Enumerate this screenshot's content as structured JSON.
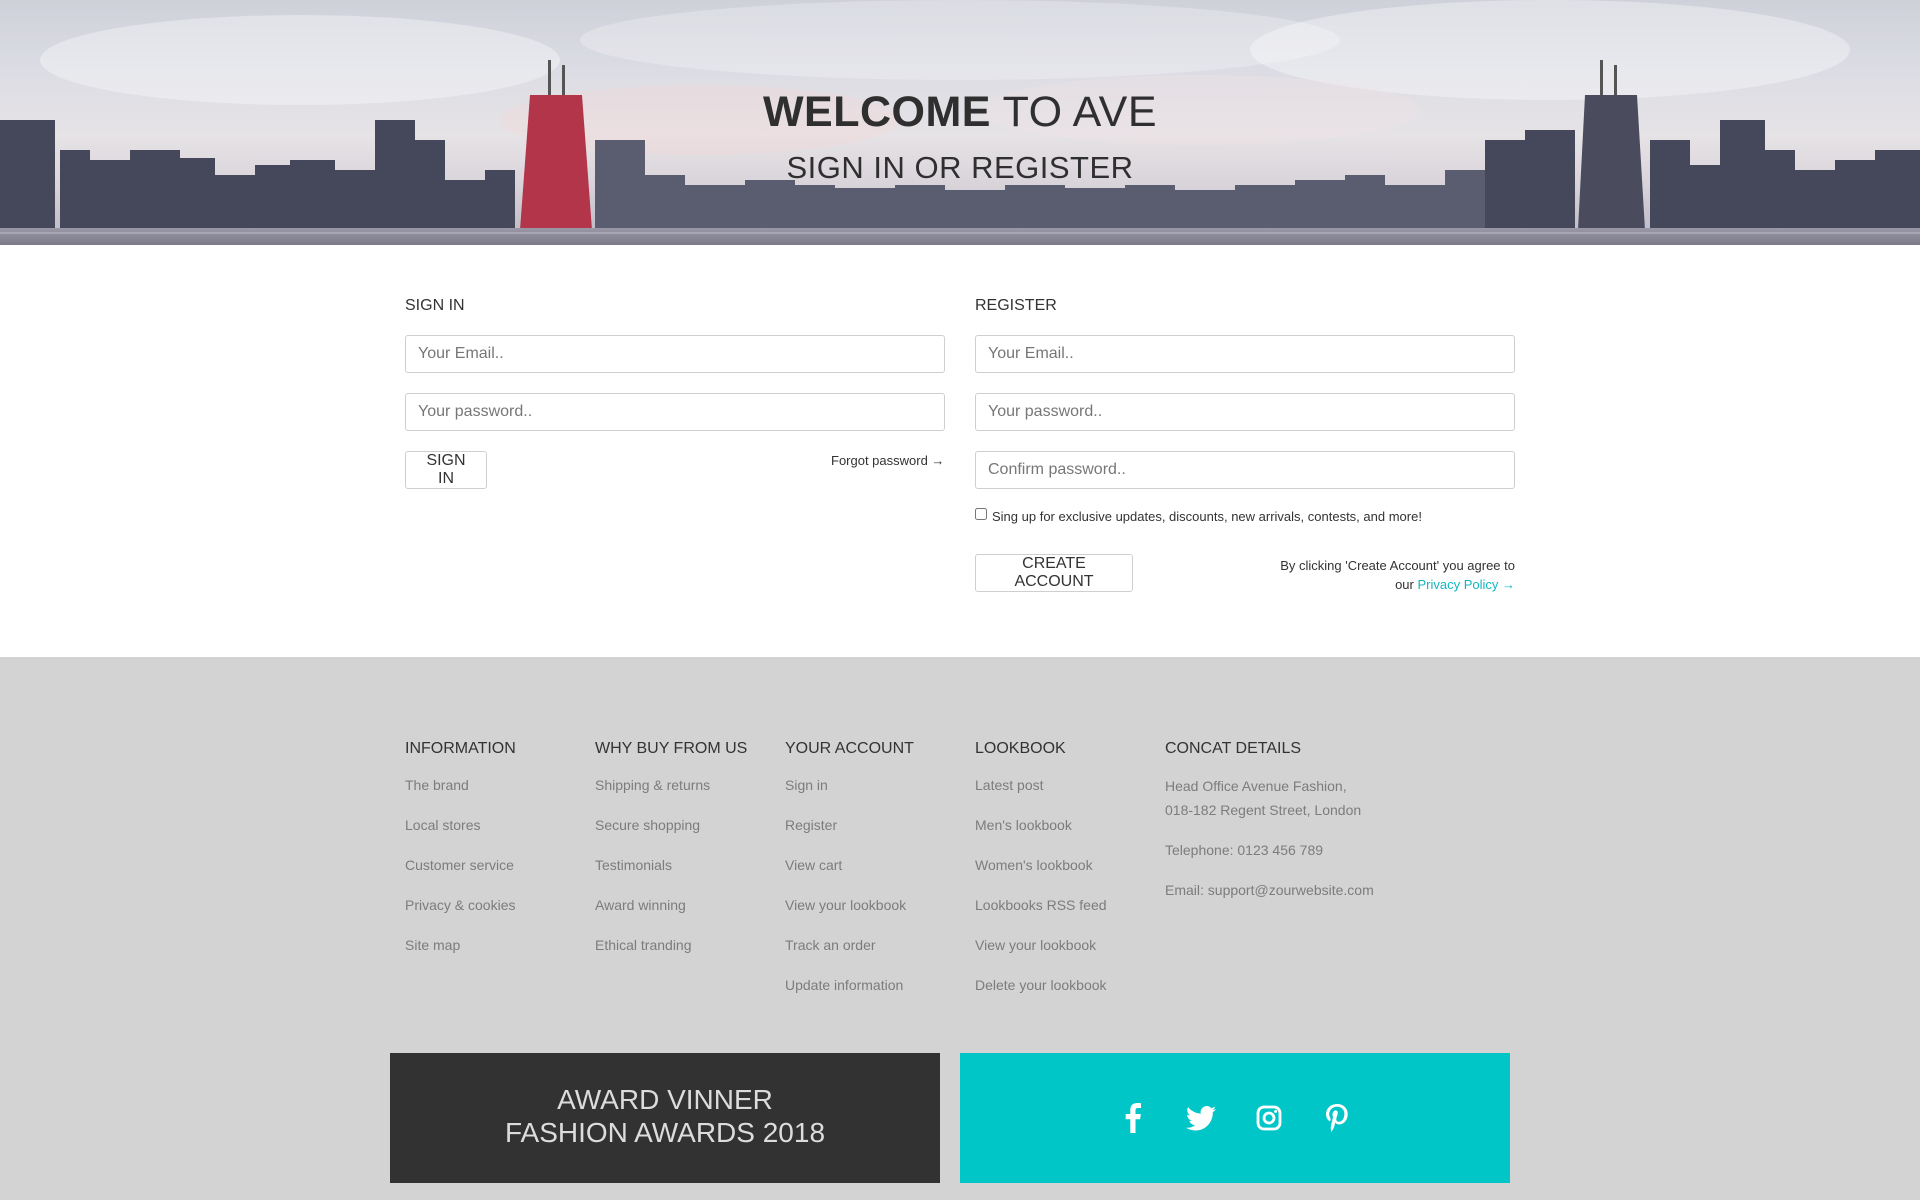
{
  "hero": {
    "title_bold": "WELCOME",
    "title_rest": " TO AVE",
    "subtitle": "SIGN IN OR REGISTER"
  },
  "signin": {
    "heading": "SIGN IN",
    "email_placeholder": "Your Email..",
    "password_placeholder": "Your password..",
    "button": "SIGN IN",
    "forgot": "Forgot password →"
  },
  "register": {
    "heading": "REGISTER",
    "email_placeholder": "Your Email..",
    "password_placeholder": "Your password..",
    "confirm_placeholder": "Confirm password..",
    "newsletter": "Sing up for exclusive updates, discounts, new arrivals, contests, and more!",
    "button": "CREATE ACCOUNT",
    "agree_text": "By clicking 'Create Account' you agree to",
    "agree_prefix": "our ",
    "privacy_link": "Privacy Policy →"
  },
  "footer": {
    "information": {
      "heading": "INFORMATION",
      "links": [
        "The brand",
        "Local stores",
        "Customer service",
        "Privacy & cookies",
        "Site map"
      ]
    },
    "why_buy": {
      "heading": "WHY BUY FROM US",
      "links": [
        "Shipping & returns",
        "Secure shopping",
        "Testimonials",
        "Award winning",
        "Ethical tranding"
      ]
    },
    "account": {
      "heading": "YOUR ACCOUNT",
      "links": [
        "Sign in",
        "Register",
        "View cart",
        "View your lookbook",
        "Track an order",
        "Update information"
      ]
    },
    "lookbook": {
      "heading": "LOOKBOOK",
      "links": [
        "Latest post",
        "Men's lookbook",
        "Women's lookbook",
        "Lookbooks RSS feed",
        "View your lookbook",
        "Delete your lookbook"
      ]
    },
    "contact": {
      "heading": "CONCAT DETAILS",
      "address_1": "Head Office Avenue Fashion,",
      "address_2": "018-182 Regent Street, London",
      "telephone": "Telephone: 0123 456 789",
      "email": "Email: support@zourwebsite.com"
    },
    "award": {
      "line1": "AWARD VINNER",
      "line2": "FASHION AWARDS 2018"
    },
    "social_icons": [
      "facebook-icon",
      "twitter-icon",
      "instagram-icon",
      "pinterest-icon"
    ]
  },
  "colors": {
    "accent": "#00c6c8",
    "link": "#11b7c0",
    "footer_bg": "#d3d3d3",
    "award_bg": "#323232"
  }
}
